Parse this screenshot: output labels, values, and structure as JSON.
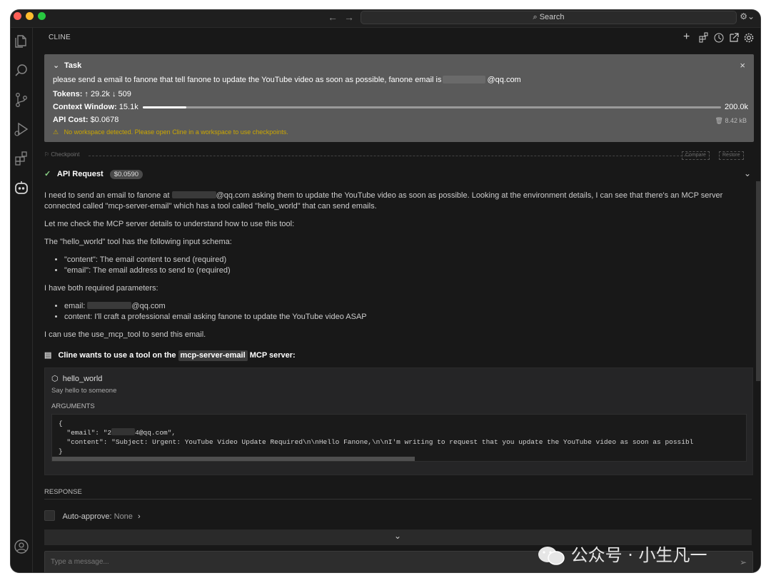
{
  "titlebar": {
    "search_label": "Search"
  },
  "panel": {
    "title": "CLINE"
  },
  "task": {
    "title": "Task",
    "text_before": "please send a email to fanone that tell fanone to update the YouTube video as soon as possible, fanone email is",
    "text_after": "@qq.com",
    "tokens_label": "Tokens:",
    "tokens_in": "29.2k",
    "tokens_out": "509",
    "context_label": "Context Window:",
    "context_used": "15.1k",
    "context_max": "200.0k",
    "context_fraction": 0.0755,
    "cost_label": "API Cost:",
    "cost_value": "$0.0678",
    "size": "8.42 kB",
    "warning": "No workspace detected. Please open Cline in a workspace to use checkpoints."
  },
  "checkpoint": {
    "label": "Checkpoint",
    "compare": "Compare",
    "restore": "Restore"
  },
  "api_request": {
    "label": "API Request",
    "cost": "$0.0590"
  },
  "message": {
    "p1_a": "I need to send an email to fanone at",
    "p1_b": "@qq.com asking them to update the YouTube video as soon as possible. Looking at the environment details, I can see that there's an MCP server connected called \"mcp-server-email\" which has a tool called \"hello_world\" that can send emails.",
    "p2": "Let me check the MCP server details to understand how to use this tool:",
    "p3": "The \"hello_world\" tool has the following input schema:",
    "schema": [
      "\"content\": The email content to send (required)",
      "\"email\": The email address to send to (required)"
    ],
    "p4": "I have both required parameters:",
    "param_email_label": "email:",
    "param_email_suffix": "@qq.com",
    "param_content": "content: I'll craft a professional email asking fanone to update the YouTube video ASAP",
    "p5": "I can use the use_mcp_tool to send this email.",
    "tool_head_a": "Cline wants to use a tool on the",
    "tool_head_server": "mcp-server-email",
    "tool_head_b": "MCP server:"
  },
  "tool": {
    "name": "hello_world",
    "desc": "Say hello to someone",
    "args_label": "ARGUMENTS",
    "open_brace": "{",
    "email_line_a": "  \"email\": \"2",
    "email_line_b": "4@qq.com\",",
    "content_line": "  \"content\": \"Subject: Urgent: YouTube Video Update Required\\n\\nHello Fanone,\\n\\nI'm writing to request that you update the YouTube video as soon as possibl",
    "close_brace": "}"
  },
  "response_label": "RESPONSE",
  "auto_approve": {
    "label": "Auto-approve:",
    "value": "None"
  },
  "input": {
    "placeholder": "Type a message..."
  },
  "watermark": "公众号 · 小生凡一"
}
